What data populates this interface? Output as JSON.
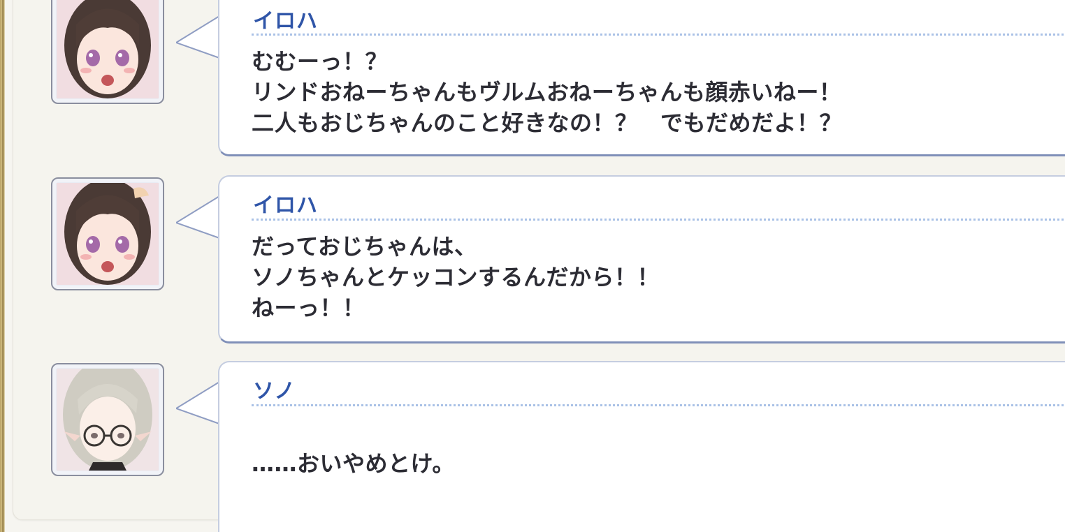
{
  "log": {
    "entries": [
      {
        "speaker": "イロハ",
        "avatar": "iroha-portrait",
        "lines": [
          "むむーっ！？",
          "リンドおねーちゃんもヴルムおねーちゃんも顔赤いねー！",
          "二人もおじちゃんのこと好きなの！？　でもだめだよ！？"
        ]
      },
      {
        "speaker": "イロハ",
        "avatar": "iroha-portrait",
        "lines": [
          "だっておじちゃんは、",
          "ソノちゃんとケッコンするんだから！！",
          "ねーっ！！"
        ]
      },
      {
        "speaker": "ソノ",
        "avatar": "sono-portrait",
        "lines": [
          "……おいやめとけ。"
        ]
      }
    ]
  },
  "colors": {
    "speaker_name": "#2f55a8",
    "dialogue_text": "#2c2c34",
    "bubble_bg": "#ffffff",
    "bubble_border": "#7f8fb8",
    "panel_bg": "#f5f4ee"
  }
}
